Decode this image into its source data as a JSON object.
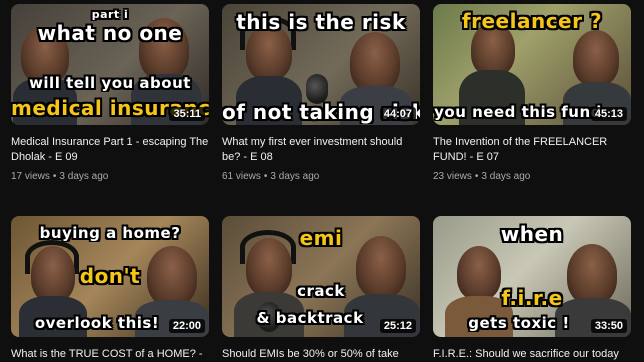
{
  "videos": [
    {
      "thumb_lines": [
        "Part I",
        "what no one",
        "will tell you about",
        "medical insurance"
      ],
      "duration": "35:11",
      "title": "Medical Insurance Part 1 - escaping The Dholak - E 09",
      "views": "17 views",
      "age": "3 days ago"
    },
    {
      "thumb_lines": [
        "this is the risk",
        "of not taking risk"
      ],
      "duration": "44:07",
      "title": "What my first ever investment should be? - E 08",
      "views": "61 views",
      "age": "3 days ago"
    },
    {
      "thumb_lines": [
        "FREELANCER ?",
        "you need this fund"
      ],
      "duration": "45:13",
      "title": "The Invention of the FREELANCER FUND! - E 07",
      "views": "23 views",
      "age": "3 days ago"
    },
    {
      "thumb_lines": [
        "Buying a home?",
        "DON'T",
        "overlook this!"
      ],
      "duration": "22:00",
      "title": "What is the TRUE COST of a HOME? -",
      "views": "",
      "age": ""
    },
    {
      "thumb_lines": [
        "EMI",
        "crack",
        "& backtrack"
      ],
      "duration": "25:12",
      "title": "Should EMIs be 30% or 50% of take",
      "views": "",
      "age": ""
    },
    {
      "thumb_lines": [
        "when",
        "F.I.R.E",
        "gets toxic !"
      ],
      "duration": "33:50",
      "title": "F.I.R.E.: Should we sacrifice our today",
      "views": "",
      "age": ""
    }
  ],
  "colors": {
    "background": "#0f0f0f",
    "caption_yellow": "#f5c518",
    "meta_gray": "#aaaaaa"
  }
}
